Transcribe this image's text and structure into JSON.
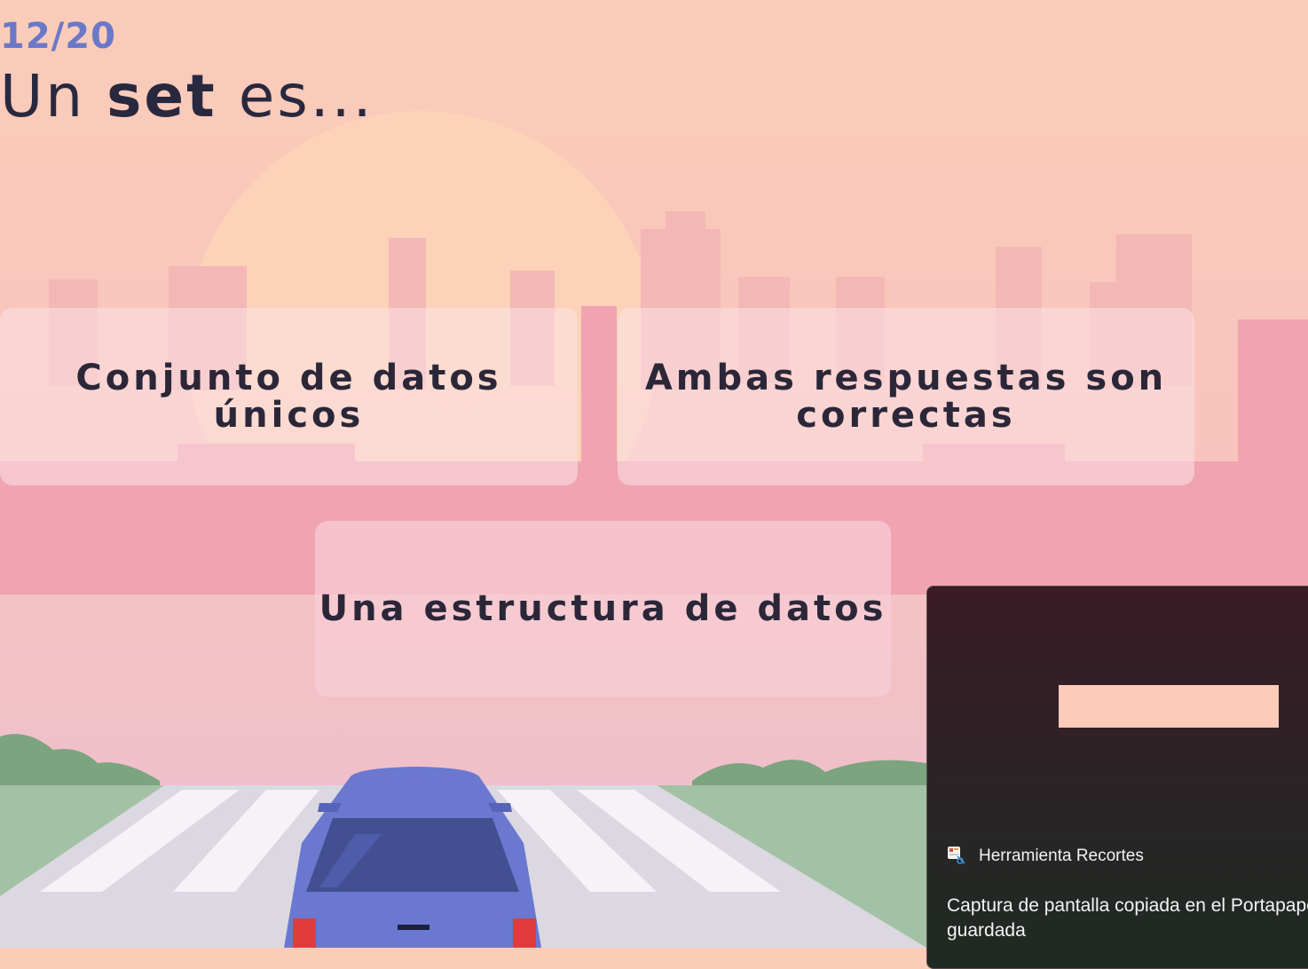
{
  "quiz": {
    "progress": "12/20",
    "question_prefix": "Un ",
    "question_bold": "set",
    "question_suffix": " es...",
    "answers": [
      {
        "line1": "Conjunto de datos",
        "line2": "únicos"
      },
      {
        "line1": "Ambas respuestas son",
        "line2": "correctas"
      },
      {
        "line1": "Una estructura de datos",
        "line2": ""
      }
    ]
  },
  "notification": {
    "app_name": "Herramienta Recortes",
    "message_line1": "Captura de pantalla copiada en el Portapape",
    "message_line2": "guardada",
    "icon": "snipping-tool-icon"
  },
  "colors": {
    "progress": "#6b78c8",
    "question_text": "#28283e",
    "car": "#6a78d0",
    "sky_top": "#fbcdb8",
    "ground_grass": "#a3c2a5"
  }
}
